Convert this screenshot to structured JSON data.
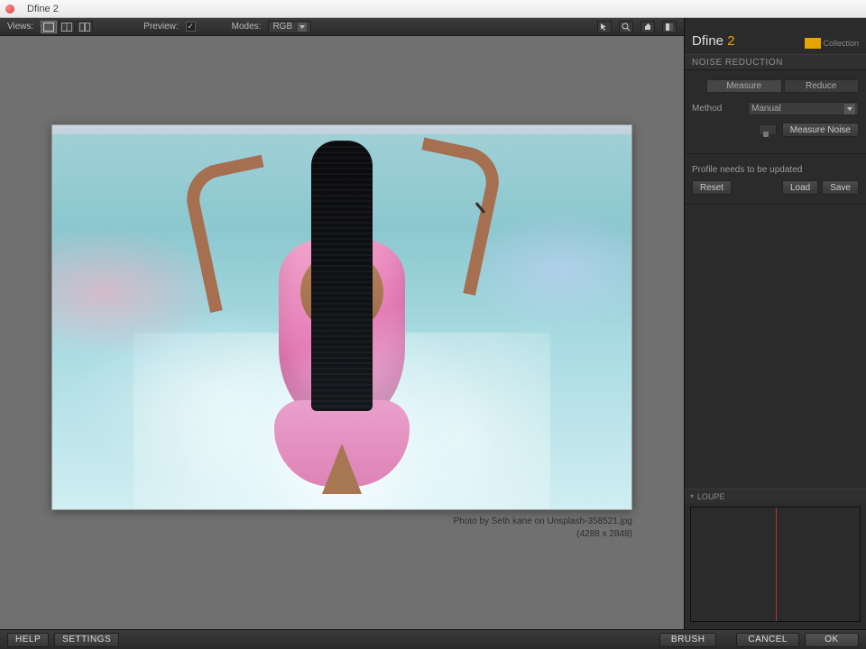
{
  "window": {
    "title": "Dfine 2"
  },
  "toolbar": {
    "views_label": "Views:",
    "preview_label": "Preview:",
    "modes_label": "Modes:",
    "mode_value": "RGB"
  },
  "image_meta": {
    "caption": "Photo by Seth kane on Unsplash-358521.jpg",
    "dimensions": "(4288 x 2848)"
  },
  "brand": {
    "name": "Dfine ",
    "version": "2",
    "logo_text": "Collection"
  },
  "panel": {
    "section_title": "NOISE REDUCTION",
    "tab_measure": "Measure",
    "tab_reduce": "Reduce",
    "method_label": "Method",
    "method_value": "Manual",
    "measure_noise": "Measure Noise",
    "profile_note": "Profile needs to be updated",
    "reset": "Reset",
    "load": "Load",
    "save": "Save"
  },
  "loupe": {
    "title": "LOUPE"
  },
  "footer": {
    "help": "HELP",
    "settings": "SETTINGS",
    "brush": "BRUSH",
    "cancel": "CANCEL",
    "ok": "OK"
  }
}
